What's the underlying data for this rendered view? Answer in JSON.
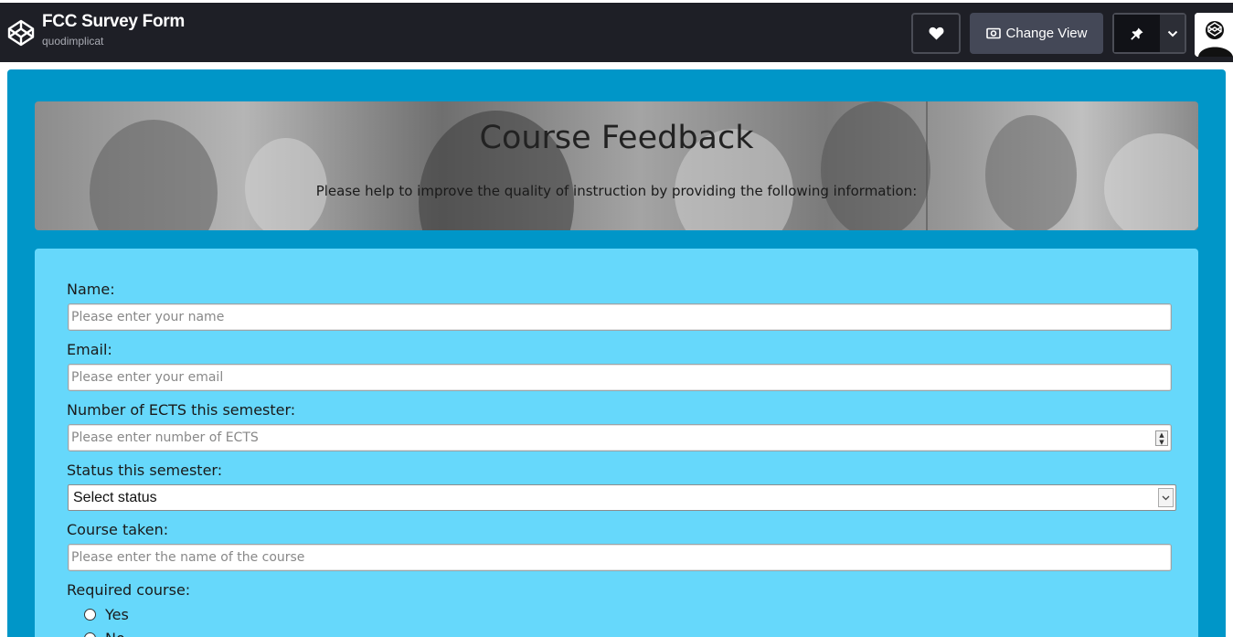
{
  "header": {
    "pen_title": "FCC Survey Form",
    "pen_author": "quodimplicat",
    "change_view_label": "Change View"
  },
  "hero": {
    "title": "Course Feedback",
    "subtitle": "Please help to improve the quality of instruction by providing the following information:"
  },
  "form": {
    "name_label": "Name:",
    "name_placeholder": "Please enter your name",
    "email_label": "Email:",
    "email_placeholder": "Please enter your email",
    "ects_label": "Number of ECTS this semester:",
    "ects_placeholder": "Please enter number of ECTS",
    "status_label": "Status this semester:",
    "status_selected": "Select status",
    "course_label": "Course taken:",
    "course_placeholder": "Please enter the name of the course",
    "required_label": "Required course:",
    "required_options": [
      "Yes",
      "No"
    ]
  },
  "colors": {
    "topbar": "#1e1f26",
    "outer_background": "#0096c8",
    "form_panel": "#66d8fb"
  },
  "icons": {
    "logo": "codepen-logo-icon",
    "heart": "heart-icon",
    "change_view": "eye-icon",
    "pin": "pin-icon",
    "caret": "chevron-down-icon"
  }
}
